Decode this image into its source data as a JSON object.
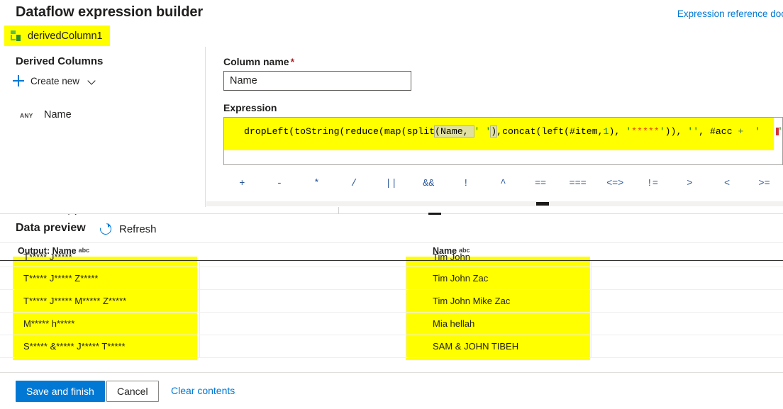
{
  "header": {
    "title": "Dataflow expression builder",
    "doc_link": "Expression reference doc",
    "stream_name": "derivedColumn1",
    "stream_icon": "derived-column-icon"
  },
  "sidebar": {
    "heading": "Derived Columns",
    "create_new_label": "Create new",
    "plus_icon": "plus-icon",
    "chevron_icon": "chevron-down-icon",
    "columns": [
      {
        "type": "ANY",
        "name": "Name"
      }
    ]
  },
  "editor": {
    "column_name_label": "Column name",
    "required_marker": "*",
    "column_name_value": "Name",
    "column_name_placeholder": "Name",
    "expression_label": "Expression",
    "expression_text": "dropLeft(toString(reduce(map(split(Name, ' '),concat(left(#item,1), '*****')), '', #acc +  ' '",
    "expression_tokens": [
      {
        "t": "dropLeft(toString(reduce(map(split",
        "c": "plain"
      },
      {
        "t": "(Name, ",
        "c": "bracket-match"
      },
      {
        "t": "'",
        "c": "quote"
      },
      {
        "t": " ",
        "c": "string"
      },
      {
        "t": "'",
        "c": "quote"
      },
      {
        "t": ")",
        "c": "bracket-match"
      },
      {
        "t": ",concat(left(#item,",
        "c": "plain"
      },
      {
        "t": "1",
        "c": "number"
      },
      {
        "t": "), ",
        "c": "plain"
      },
      {
        "t": "'",
        "c": "quote"
      },
      {
        "t": "*****",
        "c": "string"
      },
      {
        "t": "'",
        "c": "quote"
      },
      {
        "t": ")), ",
        "c": "plain"
      },
      {
        "t": "'",
        "c": "quote"
      },
      {
        "t": "'",
        "c": "quote"
      },
      {
        "t": ", #acc ",
        "c": "plain"
      },
      {
        "t": "+",
        "c": "operator"
      },
      {
        "t": "  ",
        "c": "plain"
      },
      {
        "t": "'",
        "c": "quote"
      },
      {
        "t": "   ",
        "c": "string"
      },
      {
        "t": "'",
        "c": "quote"
      }
    ],
    "operators": [
      "+",
      "-",
      "*",
      "/",
      "||",
      "&&",
      "!",
      "^",
      "==",
      "===",
      "<=>",
      "!=",
      ">",
      "<",
      ">="
    ]
  },
  "preview": {
    "title": "Data preview",
    "refresh_label": "Refresh",
    "refresh_icon": "refresh-icon",
    "columns": [
      {
        "label": "Output: Name",
        "type_badge": "abc"
      },
      {
        "label": "Name",
        "type_badge": "abc"
      }
    ],
    "rows": [
      {
        "output": "T***** J*****",
        "name": "Tim John"
      },
      {
        "output": "T***** J***** Z*****",
        "name": "Tim John Zac"
      },
      {
        "output": "T***** J***** M***** Z*****",
        "name": "Tim John Mike Zac"
      },
      {
        "output": "M***** h*****",
        "name": "Mia hellah"
      },
      {
        "output": "S***** &***** J***** T*****",
        "name": "SAM & JOHN TIBEH"
      }
    ]
  },
  "footer": {
    "save_label": "Save and finish",
    "cancel_label": "Cancel",
    "clear_label": "Clear contents"
  },
  "colors": {
    "accent": "#0078d4",
    "highlight": "#ffff00",
    "required": "#a4262c",
    "operator_text": "#2b5797",
    "string_literal": "#e03a00",
    "quote": "#008000",
    "number": "#098658"
  }
}
